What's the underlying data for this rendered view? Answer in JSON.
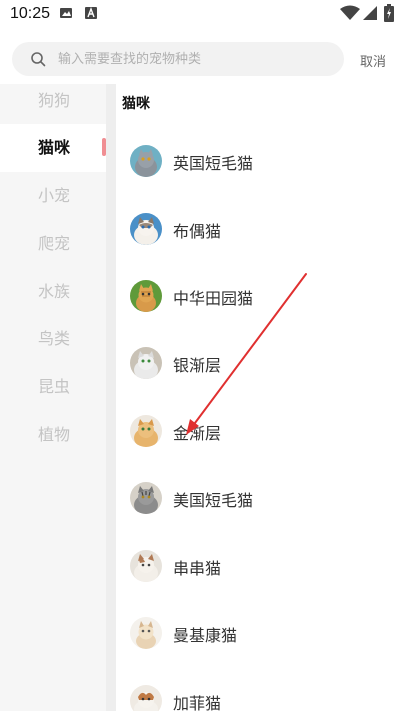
{
  "status_bar": {
    "time": "10:25",
    "icons": [
      "gallery-icon",
      "font-icon",
      "wifi-icon",
      "signal-icon",
      "battery-icon"
    ]
  },
  "search": {
    "placeholder": "输入需要查找的宠物种类",
    "value": "",
    "cancel_label": "取消"
  },
  "sidebar": {
    "active_color": "#f08e93",
    "items": [
      {
        "label": "狗狗"
      },
      {
        "label": "猫咪",
        "active": true
      },
      {
        "label": "小宠"
      },
      {
        "label": "爬宠"
      },
      {
        "label": "水族"
      },
      {
        "label": "鸟类"
      },
      {
        "label": "昆虫"
      },
      {
        "label": "植物"
      }
    ]
  },
  "main": {
    "section_title": "猫咪",
    "breeds": [
      {
        "name": "英国短毛猫",
        "avatar": "british-shorthair-photo"
      },
      {
        "name": "布偶猫",
        "avatar": "ragdoll-photo"
      },
      {
        "name": "中华田园猫",
        "avatar": "chinese-garden-cat-photo"
      },
      {
        "name": "银渐层",
        "avatar": "silver-shaded-photo"
      },
      {
        "name": "金渐层",
        "avatar": "golden-shaded-photo"
      },
      {
        "name": "美国短毛猫",
        "avatar": "american-shorthair-photo"
      },
      {
        "name": "串串猫",
        "avatar": "mixed-breed-photo"
      },
      {
        "name": "曼基康猫",
        "avatar": "munchkin-photo"
      },
      {
        "name": "加菲猫",
        "avatar": "exotic-shorthair-photo"
      }
    ]
  },
  "annotation": {
    "type": "red-arrow",
    "color": "#e03030",
    "points_to": "金渐层"
  }
}
